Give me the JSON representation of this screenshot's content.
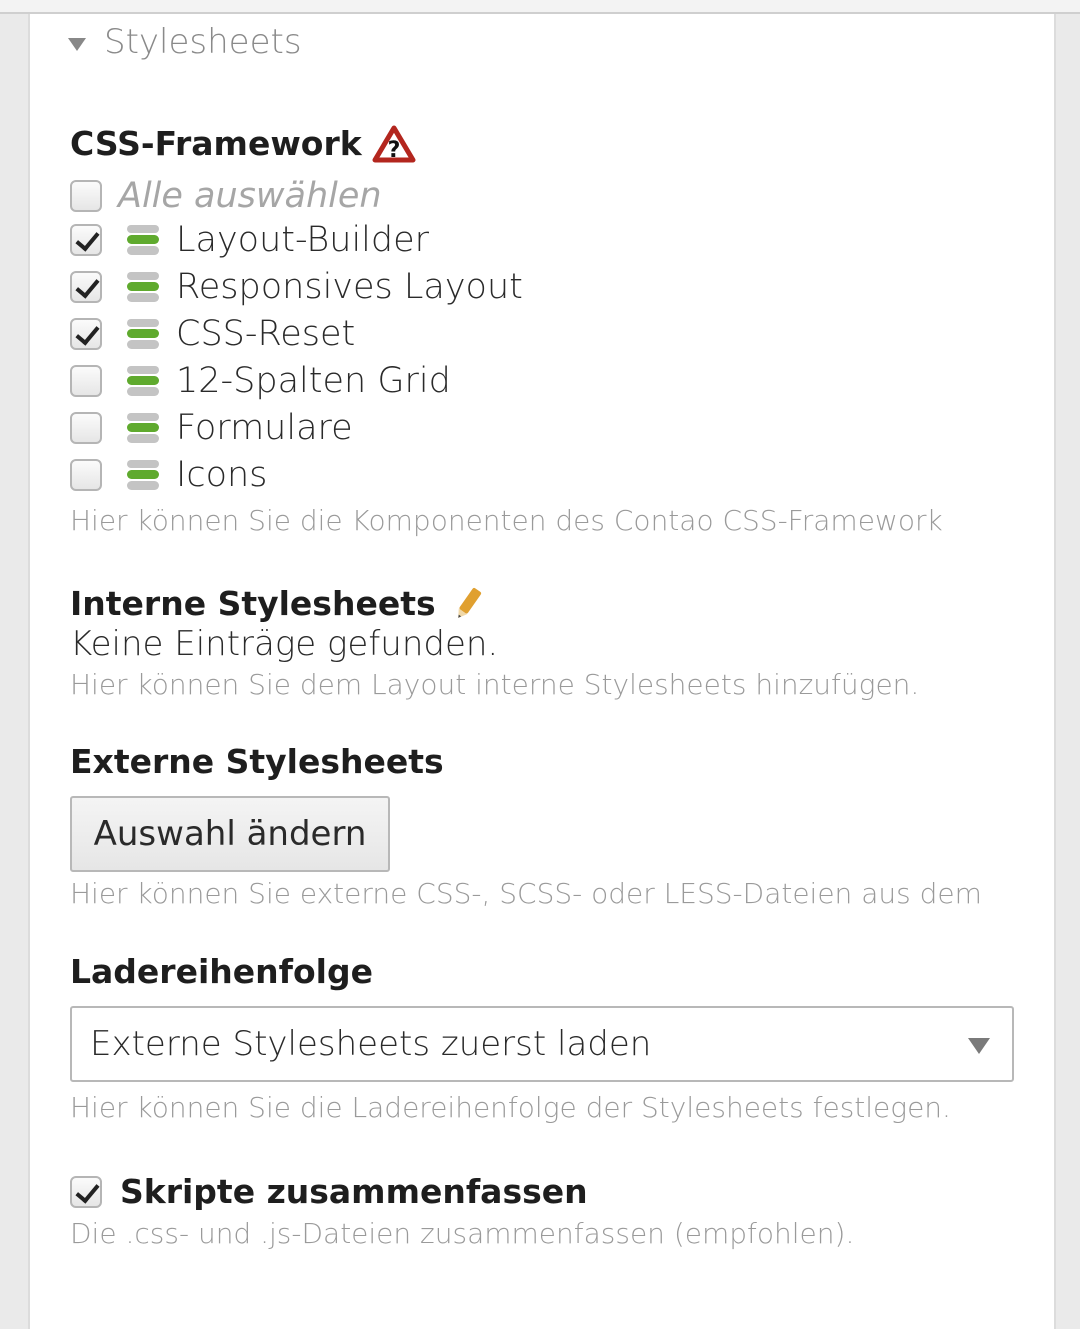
{
  "section": {
    "title": "Stylesheets"
  },
  "framework": {
    "heading": "CSS-Framework",
    "select_all": "Alle auswählen",
    "items": [
      {
        "label": "Layout-Builder",
        "checked": true
      },
      {
        "label": "Responsives Layout",
        "checked": true
      },
      {
        "label": "CSS-Reset",
        "checked": true
      },
      {
        "label": "12-Spalten Grid",
        "checked": false
      },
      {
        "label": "Formulare",
        "checked": false
      },
      {
        "label": "Icons",
        "checked": false
      }
    ],
    "help": "Hier können Sie die Komponenten des Contao CSS-Framework"
  },
  "internal": {
    "heading": "Interne Stylesheets",
    "empty": "Keine Einträge gefunden.",
    "help": "Hier können Sie dem Layout interne Stylesheets hinzufügen."
  },
  "external": {
    "heading": "Externe Stylesheets",
    "button": "Auswahl ändern",
    "help": "Hier können Sie externe CSS-, SCSS- oder LESS-Dateien aus dem"
  },
  "order": {
    "heading": "Ladereihenfolge",
    "selected": "Externe Stylesheets zuerst laden",
    "help": "Hier können Sie die Ladereihenfolge der Stylesheets festlegen."
  },
  "combine": {
    "label": "Skripte zusammenfassen",
    "checked": true,
    "help": "Die .css- und .js-Dateien zusammenfassen (empfohlen)."
  },
  "colors": {
    "accent_green": "#5faa2e",
    "warning_red": "#b3261e",
    "pencil": "#e0a030"
  }
}
